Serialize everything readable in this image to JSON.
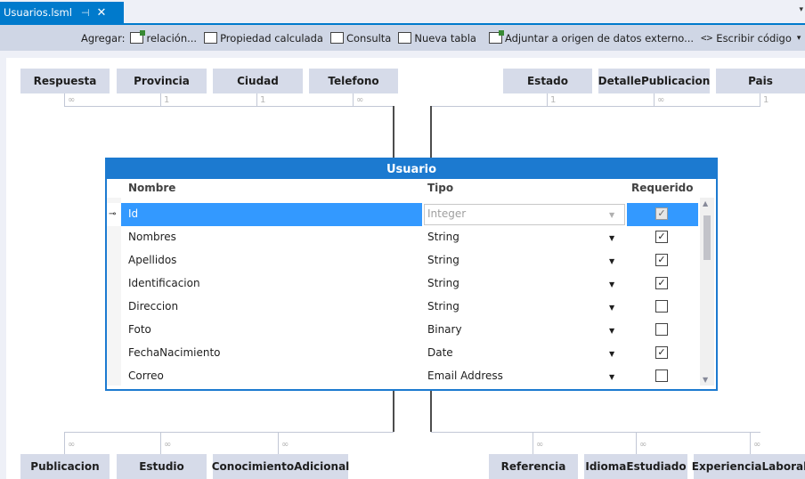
{
  "tab": {
    "title": "Usuarios.lsml",
    "pin": "⊣",
    "close": "✕",
    "overflow": "▾"
  },
  "toolbar": {
    "add_label": "Agregar:",
    "relation": "relación...",
    "computed": "Propiedad calculada",
    "query": "Consulta",
    "new_table": "Nueva tabla",
    "attach": "Adjuntar a origen de datos externo...",
    "write_code": "Escribir código",
    "code_glyph": "<>",
    "caret": "▾"
  },
  "top_entities": [
    {
      "name": "Respuesta",
      "mult": "∞"
    },
    {
      "name": "Provincia",
      "mult": "1"
    },
    {
      "name": "Ciudad",
      "mult": "1"
    },
    {
      "name": "Telefono",
      "mult": "∞"
    },
    {
      "name": "Estado",
      "mult": "1"
    },
    {
      "name": "DetallePublicacion",
      "mult": "∞"
    },
    {
      "name": "Pais",
      "mult": "1"
    }
  ],
  "bottom_entities": [
    {
      "name": "Publicacion",
      "mult": "∞"
    },
    {
      "name": "Estudio",
      "mult": "∞"
    },
    {
      "name": "ConocimientoAdicional",
      "mult": "∞"
    },
    {
      "name": "Referencia",
      "mult": "∞"
    },
    {
      "name": "IdiomaEstudiado",
      "mult": "∞"
    },
    {
      "name": "ExperienciaLaboral",
      "mult": "∞"
    }
  ],
  "entity": {
    "title": "Usuario",
    "columns": {
      "name": "Nombre",
      "type": "Tipo",
      "required": "Requerido"
    },
    "rows": [
      {
        "name": "Id",
        "type": "Integer",
        "required": true,
        "key": true
      },
      {
        "name": "Nombres",
        "type": "String",
        "required": true
      },
      {
        "name": "Apellidos",
        "type": "String",
        "required": true
      },
      {
        "name": "Identificacion",
        "type": "String",
        "required": true
      },
      {
        "name": "Direccion",
        "type": "String",
        "required": false
      },
      {
        "name": "Foto",
        "type": "Binary",
        "required": false
      },
      {
        "name": "FechaNacimiento",
        "type": "Date",
        "required": true
      },
      {
        "name": "Correo",
        "type": "Email Address",
        "required": false
      }
    ]
  },
  "colors": {
    "accent": "#007acc",
    "selection": "#3399ff",
    "entity_bg": "#d6dbe9"
  }
}
